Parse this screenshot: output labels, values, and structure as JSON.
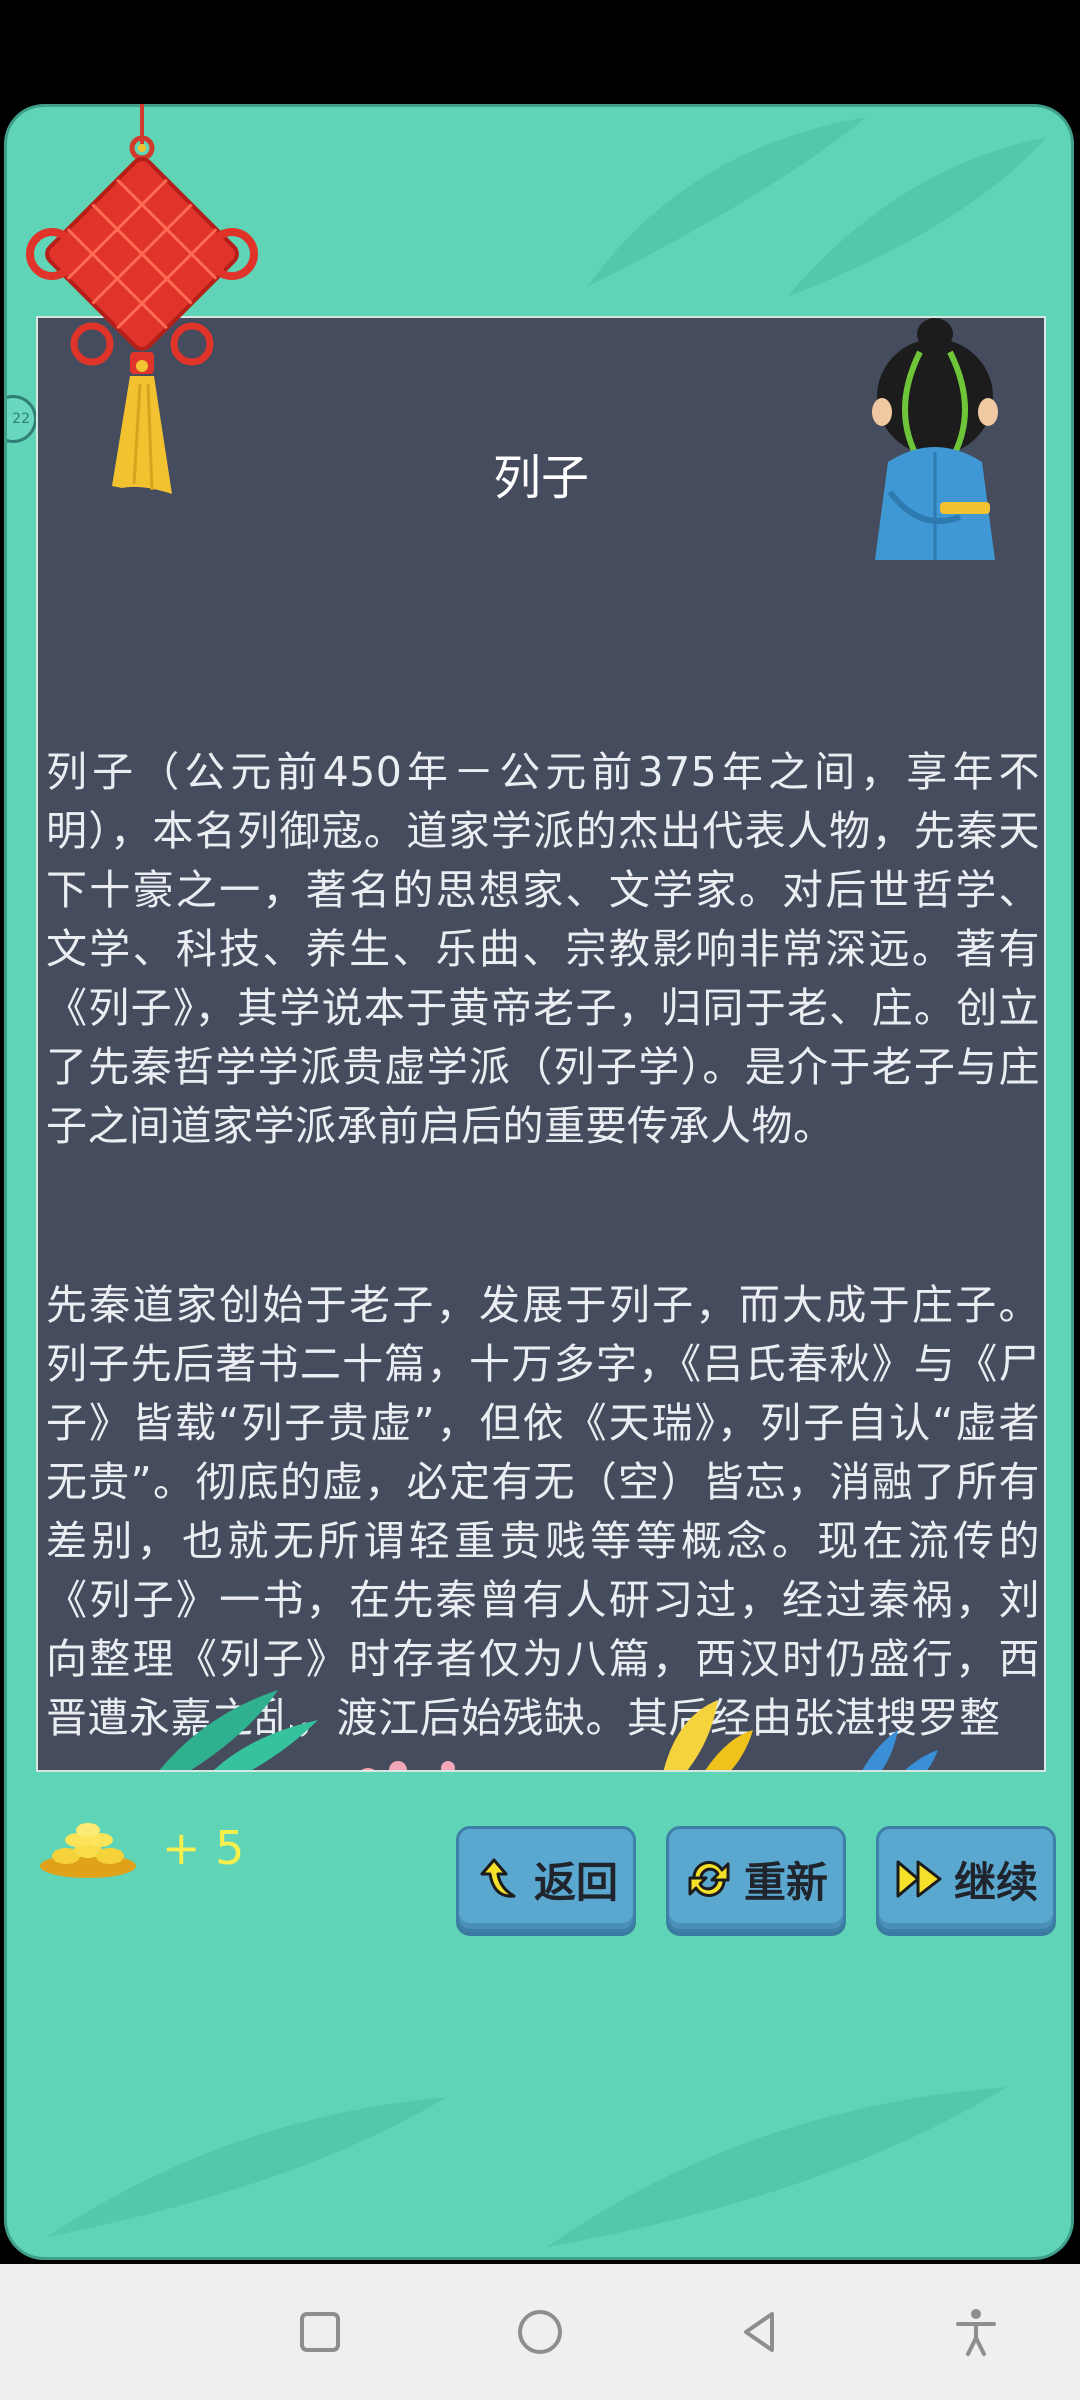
{
  "article": {
    "title": "列子",
    "paragraphs": [
      "列子（公元前450年－公元前375年之间，享年不明），本名列御寇。道家学派的杰出代表人物，先秦天下十豪之一，著名的思想家、文学家。对后世哲学、文学、科技、养生、乐曲、宗教影响非常深远。著有《列子》，其学说本于黄帝老子，归同于老、庄。创立了先秦哲学学派贵虚学派（列子学）。是介于老子与庄子之间道家学派承前启后的重要传承人物。",
      "先秦道家创始于老子，发展于列子，而大成于庄子。列子先后著书二十篇，十万多字，《吕氏春秋》与《尸子》皆载“列子贵虚”，但依《天瑞》，列子自认“虚者无贵”。彻底的虚，必定有无（空）皆忘，消融了所有差别，也就无所谓轻重贵贱等等概念。现在流传的《列子》一书，在先秦曾有人研习过，经过秦祸，刘向整理《列子》时存者仅为八篇，西汉时仍盛行，西晋遭永嘉之乱，渡江后始残缺。其后经由张湛搜罗整"
    ]
  },
  "reward": {
    "coin_count": "+ 5"
  },
  "buttons": {
    "back": "返回",
    "restart": "重新",
    "continue": "继续"
  },
  "side_badge": {
    "text": "22"
  },
  "icons": {
    "knot": "chinese-knot-icon",
    "character": "scholar-character-icon",
    "coins": "gold-coins-icon",
    "back": "back-arrow-icon",
    "restart": "refresh-icon",
    "continue": "fast-forward-icon",
    "nav_recent": "square-icon",
    "nav_home": "circle-icon",
    "nav_back": "triangle-back-icon",
    "nav_accessibility": "accessibility-icon"
  },
  "colors": {
    "background": "#5fd4b6",
    "panel": "#454c5d",
    "coin_text": "#f7ef4c",
    "button": "#5aa7cf"
  }
}
